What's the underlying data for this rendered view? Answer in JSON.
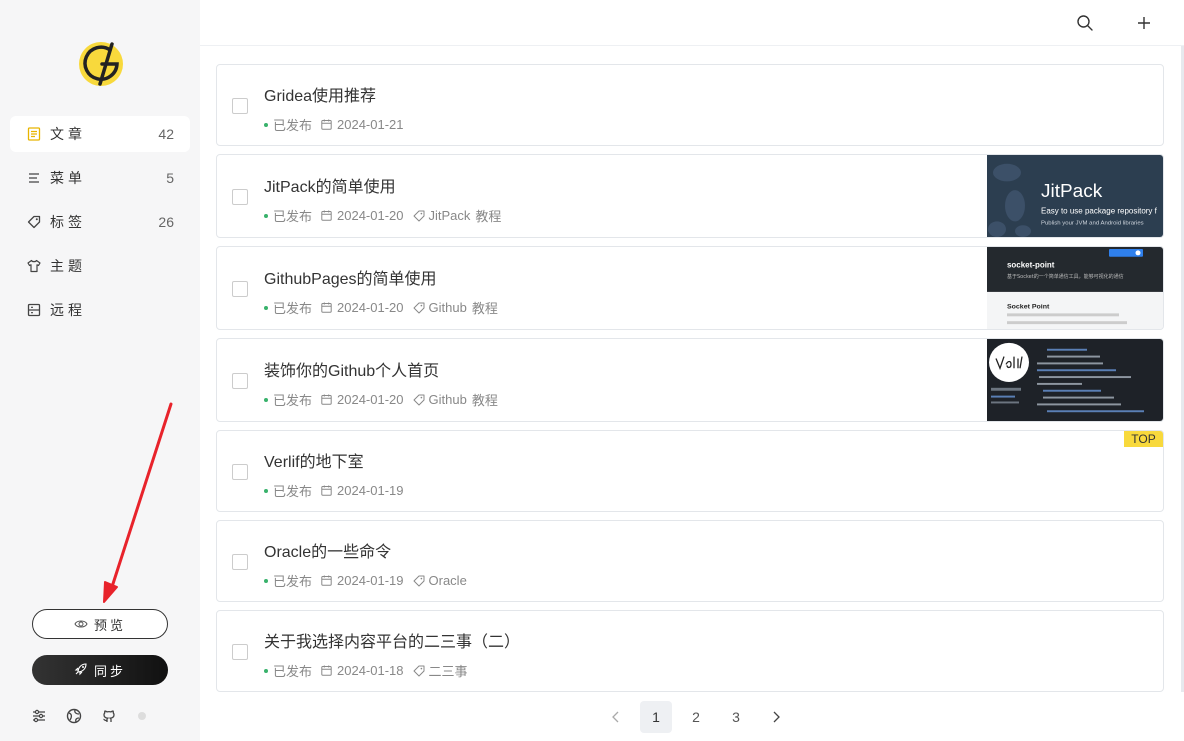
{
  "sidebar": {
    "nav": [
      {
        "label": "文章",
        "count": "42",
        "icon": "article-icon",
        "active": true
      },
      {
        "label": "菜单",
        "count": "5",
        "icon": "menu-icon",
        "active": false
      },
      {
        "label": "标签",
        "count": "26",
        "icon": "tag-icon",
        "active": false
      },
      {
        "label": "主题",
        "count": "",
        "icon": "shirt-icon",
        "active": false
      },
      {
        "label": "远程",
        "count": "",
        "icon": "remote-icon",
        "active": false
      }
    ],
    "preview_label": "预览",
    "sync_label": "同步"
  },
  "posts": [
    {
      "title": "Gridea使用推荐",
      "status": "已发布",
      "date": "2024-01-21",
      "tags": [],
      "thumb": null,
      "top": false
    },
    {
      "title": "JitPack的简单使用",
      "status": "已发布",
      "date": "2024-01-20",
      "tags": [
        "JitPack",
        "教程"
      ],
      "thumb": "jitpack",
      "top": false
    },
    {
      "title": "GithubPages的简单使用",
      "status": "已发布",
      "date": "2024-01-20",
      "tags": [
        "Github",
        "教程"
      ],
      "thumb": "socketpoint",
      "top": false
    },
    {
      "title": "装饰你的Github个人首页",
      "status": "已发布",
      "date": "2024-01-20",
      "tags": [
        "Github",
        "教程"
      ],
      "thumb": "verlif",
      "top": false
    },
    {
      "title": "Verlif的地下室",
      "status": "已发布",
      "date": "2024-01-19",
      "tags": [],
      "thumb": null,
      "top": true
    },
    {
      "title": "Oracle的一些命令",
      "status": "已发布",
      "date": "2024-01-19",
      "tags": [
        "Oracle"
      ],
      "thumb": null,
      "top": false
    },
    {
      "title": "关于我选择内容平台的二三事（二）",
      "status": "已发布",
      "date": "2024-01-18",
      "tags": [
        "二三事"
      ],
      "thumb": null,
      "top": false
    }
  ],
  "thumbs": {
    "jitpack": {
      "title": "JitPack",
      "line1": "Easy to use package repository f",
      "line2": "Publish your JVM and Android libraries"
    },
    "socketpoint": {
      "title": "socket-point",
      "subtitle": "基于Socket的一个简单通信工具，能够可视化的通信",
      "heading": "Socket Point"
    }
  },
  "top_badge": "TOP",
  "pagination": {
    "pages": [
      "1",
      "2",
      "3"
    ],
    "current": "1"
  },
  "colors": {
    "accent_yellow": "#f8d93c",
    "published_green": "#38b26b",
    "annotation_red": "#e8232b"
  }
}
